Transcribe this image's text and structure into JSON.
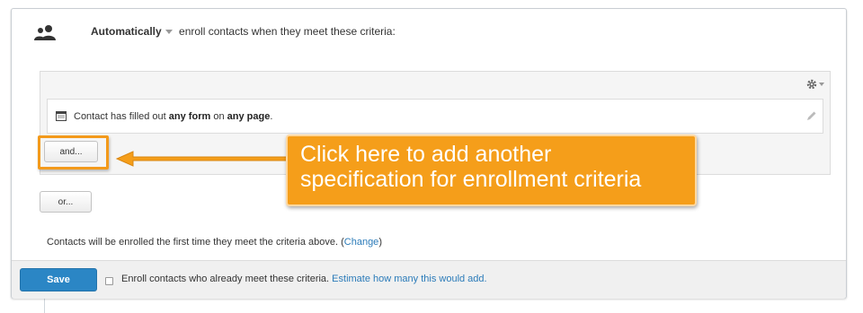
{
  "header": {
    "mode": "Automatically",
    "rest": "enroll contacts when they meet these criteria:"
  },
  "icons": {
    "people": "people-icon",
    "settings": "gear-icon",
    "calendar": "form-icon",
    "edit": "pencil-icon"
  },
  "filter": {
    "prefix": "Contact has filled out ",
    "bold1": "any form",
    "mid": " on ",
    "bold2": "any page",
    "suffix": "."
  },
  "buttons": {
    "and": "and...",
    "or": "or...",
    "save": "Save"
  },
  "note": {
    "text": "Contacts will be enrolled the first time they meet the criteria above. (",
    "link": "Change",
    "close": ")"
  },
  "footer": {
    "checkbox_label": "Enroll contacts who already meet these criteria.",
    "estimate_link": "Estimate how many this would add."
  },
  "callout": {
    "line1": "Click here to add another",
    "line2": "specification for enrollment criteria"
  },
  "colors": {
    "accent_orange": "#f59e1a",
    "save_blue": "#2b86c5",
    "link_blue": "#2b7bb9"
  }
}
